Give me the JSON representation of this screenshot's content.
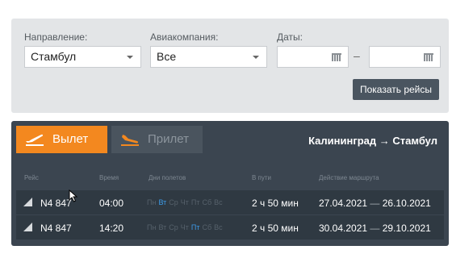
{
  "filters": {
    "direction_label": "Направление:",
    "direction_value": "Стамбул",
    "airline_label": "Авиакомпания:",
    "airline_value": "Все",
    "dates_label": "Даты:",
    "date_from": "",
    "date_to": "",
    "dates_separator": "–",
    "show_button": "Показать рейсы"
  },
  "board": {
    "tab_departure": "Вылет",
    "tab_arrival": "Прилет",
    "active_tab": "departure",
    "route": "Калининград → Стамбул",
    "columns": [
      "Рейс",
      "Время",
      "Дни полетов",
      "В пути",
      "Действие маршрута"
    ],
    "weekdays": [
      "Пн",
      "Вт",
      "Ср",
      "Чт",
      "Пт",
      "Сб",
      "Вс"
    ],
    "rows": [
      {
        "flight": "N4 847",
        "time": "04:00",
        "active_days": [
          "Вт"
        ],
        "duration": "2 ч 50 мин",
        "valid_from": "27.04.2021",
        "valid_to": "26.10.2021"
      },
      {
        "flight": "N4 847",
        "time": "14:20",
        "active_days": [
          "Пт"
        ],
        "duration": "2 ч 50 мин",
        "valid_from": "30.04.2021",
        "valid_to": "29.10.2021"
      }
    ],
    "validity_separator": "—"
  },
  "colors": {
    "accent": "#f3881f",
    "active_day": "#3c9be8",
    "panel": "#3b4550"
  },
  "icons": [
    "plane-takeoff-icon",
    "plane-landing-icon",
    "calendar-icon",
    "airline-logo-icon",
    "mouse-cursor-icon"
  ]
}
